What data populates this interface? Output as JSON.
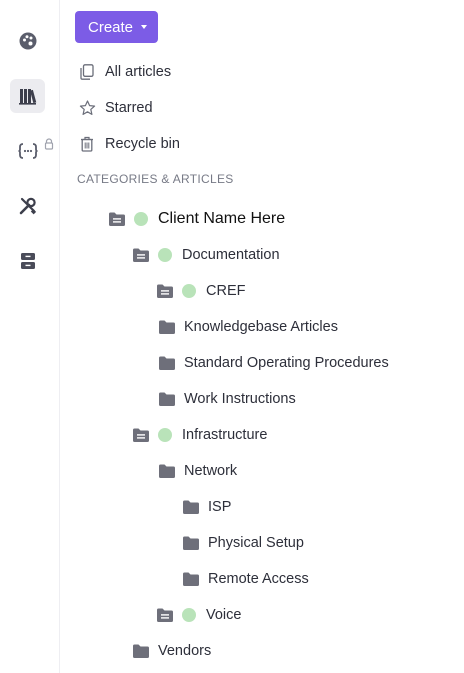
{
  "create_button": {
    "label": "Create"
  },
  "nav": {
    "all_articles": "All articles",
    "starred": "Starred",
    "recycle_bin": "Recycle bin"
  },
  "section_title": "CATEGORIES & ARTICLES",
  "status_dot_color": "#b9e3b9",
  "accent_color": "#7c5ce6",
  "tree": [
    {
      "label": "Client Name Here",
      "depth": 0,
      "open": true,
      "status": true
    },
    {
      "label": "Documentation",
      "depth": 1,
      "open": true,
      "status": true
    },
    {
      "label": "CREF",
      "depth": 2,
      "open": true,
      "status": true
    },
    {
      "label": "Knowledgebase Articles",
      "depth": 2,
      "open": false,
      "status": false
    },
    {
      "label": "Standard Operating Procedures",
      "depth": 2,
      "open": false,
      "status": false
    },
    {
      "label": "Work Instructions",
      "depth": 2,
      "open": false,
      "status": false
    },
    {
      "label": "Infrastructure",
      "depth": 1,
      "open": true,
      "status": true
    },
    {
      "label": "Network",
      "depth": 2,
      "open": false,
      "status": false
    },
    {
      "label": "ISP",
      "depth": 3,
      "open": false,
      "status": false
    },
    {
      "label": "Physical Setup",
      "depth": 3,
      "open": false,
      "status": false
    },
    {
      "label": "Remote Access",
      "depth": 3,
      "open": false,
      "status": false
    },
    {
      "label": "Voice",
      "depth": 2,
      "open": true,
      "status": true
    },
    {
      "label": "Vendors",
      "depth": 1,
      "open": false,
      "status": false
    }
  ]
}
